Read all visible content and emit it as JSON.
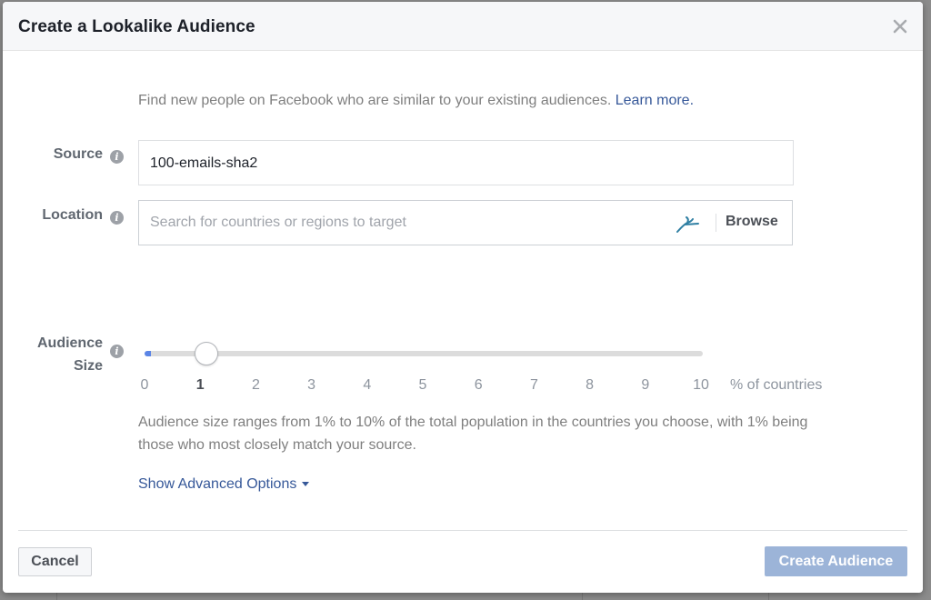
{
  "dialog": {
    "title": "Create a Lookalike Audience",
    "close_icon": "close-icon"
  },
  "intro": {
    "text": "Find new people on Facebook who are similar to your existing audiences.",
    "link": "Learn more."
  },
  "source": {
    "label": "Source",
    "info_icon": "info-icon",
    "value": "100-emails-sha2"
  },
  "location": {
    "label": "Location",
    "info_icon": "info-icon",
    "placeholder": "Search for countries or regions to target",
    "value": "",
    "globe_icon": "globe-icon",
    "browse_label": "Browse"
  },
  "audience_size": {
    "label_line1": "Audience",
    "label_line2": "Size",
    "info_icon": "info-icon",
    "min": 0,
    "max": 10,
    "value": 1,
    "ticks": [
      "0",
      "1",
      "2",
      "3",
      "4",
      "5",
      "6",
      "7",
      "8",
      "9",
      "10"
    ],
    "unit_label": "% of countries",
    "accent_color": "#5b85e6"
  },
  "help_text": "Audience size ranges from 1% to 10% of the total population in the countries you choose, with 1% being those who most closely match your source.",
  "advanced_options": {
    "label": "Show Advanced Options",
    "icon": "caret-down-icon"
  },
  "footer": {
    "cancel_label": "Cancel",
    "create_label": "Create Audience",
    "create_color": "#9cb4d8"
  }
}
